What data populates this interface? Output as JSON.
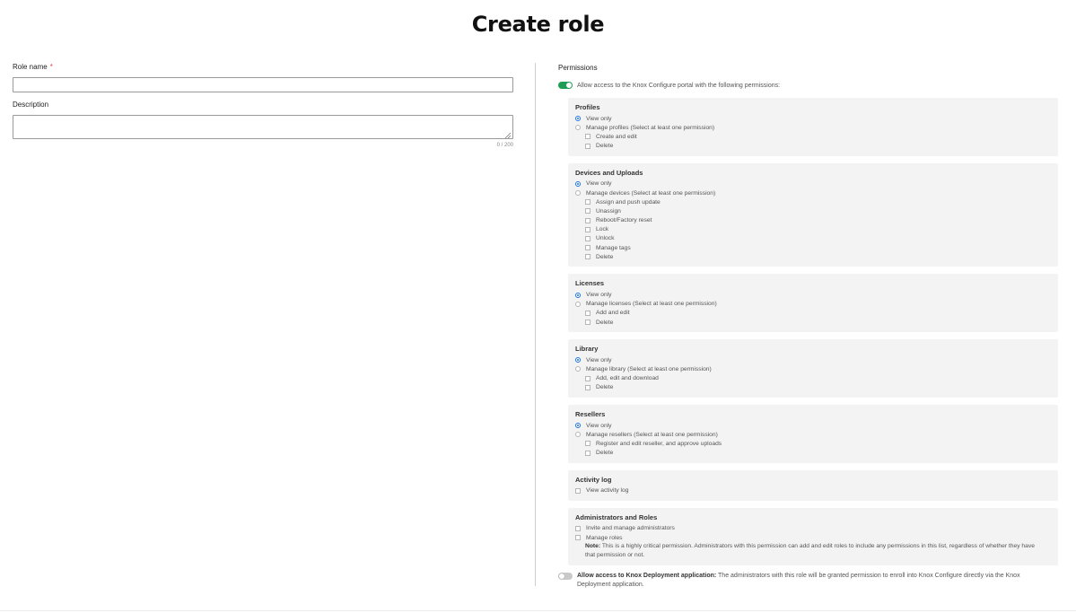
{
  "page": {
    "title": "Create role"
  },
  "role_name": {
    "label": "Role name",
    "required_mark": "*",
    "value": ""
  },
  "description": {
    "label": "Description",
    "value": "",
    "counter": "0 / 200"
  },
  "permissions": {
    "title": "Permissions",
    "portal_toggle": {
      "on": true,
      "label": "Allow access to the Knox Configure portal with the following permissions:"
    },
    "profiles": {
      "title": "Profiles",
      "view_only": "View only",
      "manage": "Manage profiles (Select at least one permission)",
      "create_edit": "Create and edit",
      "delete": "Delete"
    },
    "devices": {
      "title": "Devices and Uploads",
      "view_only": "View only",
      "manage": "Manage devices (Select at least one permission)",
      "assign_push": "Assign and push update",
      "unassign": "Unassign",
      "reboot_reset": "Reboot/Factory reset",
      "lock": "Lock",
      "unlock": "Unlock",
      "manage_tags": "Manage tags",
      "delete": "Delete"
    },
    "licenses": {
      "title": "Licenses",
      "view_only": "View only",
      "manage": "Manage licenses (Select at least one permission)",
      "add_edit": "Add and edit",
      "delete": "Delete"
    },
    "library": {
      "title": "Library",
      "view_only": "View only",
      "manage": "Manage library (Select at least one permission)",
      "add_edit_download": "Add, edit and download",
      "delete": "Delete"
    },
    "resellers": {
      "title": "Resellers",
      "view_only": "View only",
      "manage": "Manage resellers (Select at least one permission)",
      "register_edit": "Register and edit reseller, and approve uploads",
      "delete": "Delete"
    },
    "activity_log": {
      "title": "Activity log",
      "view": "View activity log"
    },
    "admins_roles": {
      "title": "Administrators and Roles",
      "invite_manage": "Invite and manage administrators",
      "manage_roles": "Manage roles",
      "note_label": "Note:",
      "note_text": "This is a highly critical permission. Administrators with this permission can add and edit roles to include any permissions in this list, regardless of whether they have that permission or not."
    },
    "deployment_toggle": {
      "on": false,
      "label_bold": "Allow access to Knox Deployment application:",
      "label_text": "The administrators with this role will be granted permission to enroll into Knox Configure directly via the Knox Deployment application."
    }
  },
  "colors": {
    "toggle_on": "#1f9d55",
    "radio_checked": "#1a73e8",
    "required": "#e0403a",
    "section_bg": "#f3f3f3"
  }
}
